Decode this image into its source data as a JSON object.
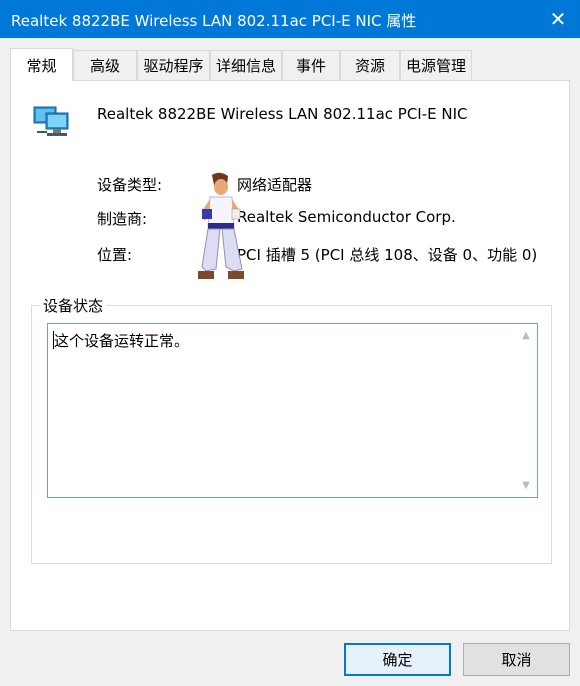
{
  "window": {
    "title": "Realtek 8822BE Wireless LAN 802.11ac PCI-E NIC 属性",
    "close_glyph": "✕"
  },
  "tabs": [
    {
      "label": "常规",
      "active": true
    },
    {
      "label": "高级"
    },
    {
      "label": "驱动程序"
    },
    {
      "label": "详细信息"
    },
    {
      "label": "事件"
    },
    {
      "label": "资源"
    },
    {
      "label": "电源管理"
    }
  ],
  "device": {
    "icon": "network-adapter-icon",
    "name": "Realtek 8822BE Wireless LAN 802.11ac PCI-E NIC",
    "properties": [
      {
        "label": "设备类型:",
        "value": "网络适配器"
      },
      {
        "label": "制造商:",
        "value": "Realtek Semiconductor Corp."
      },
      {
        "label": "位置:",
        "value": "PCI 插槽 5 (PCI 总线 108、设备 0、功能 0)"
      }
    ]
  },
  "status": {
    "group_title": "设备状态",
    "text": "这个设备运转正常。"
  },
  "buttons": {
    "ok": "确定",
    "cancel": "取消"
  },
  "colors": {
    "titlebar": "#0078d7",
    "accent": "#0078d7"
  }
}
